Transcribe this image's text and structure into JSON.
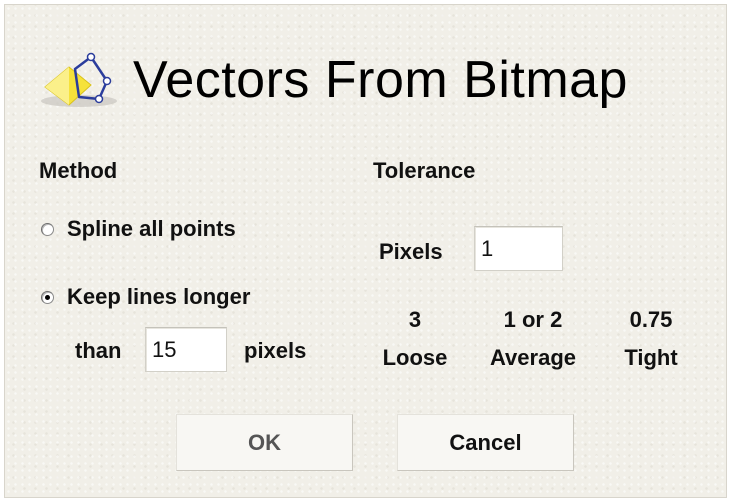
{
  "dialog": {
    "title": "Vectors From Bitmap",
    "icon": "vector-bitmap-app-icon"
  },
  "method": {
    "heading": "Method",
    "options": [
      {
        "label": "Spline all points",
        "checked": false
      },
      {
        "label": "Keep lines longer",
        "checked": true
      }
    ],
    "than_label": "than",
    "min_length_value": "15",
    "pixels_unit": "pixels"
  },
  "tolerance": {
    "heading": "Tolerance",
    "pixels_label": "Pixels",
    "pixels_value": "1",
    "scale": [
      {
        "value": "3",
        "label": "Loose"
      },
      {
        "value": "1 or 2",
        "label": "Average"
      },
      {
        "value": "0.75",
        "label": "Tight"
      }
    ]
  },
  "buttons": {
    "ok_label": "OK",
    "cancel_label": "Cancel"
  },
  "colors": {
    "dialog_background": "#f1efe8",
    "icon_yellow": "#f6e23a",
    "icon_blue": "#2b3d9c",
    "ok_text_disabled_look": "#555555"
  }
}
